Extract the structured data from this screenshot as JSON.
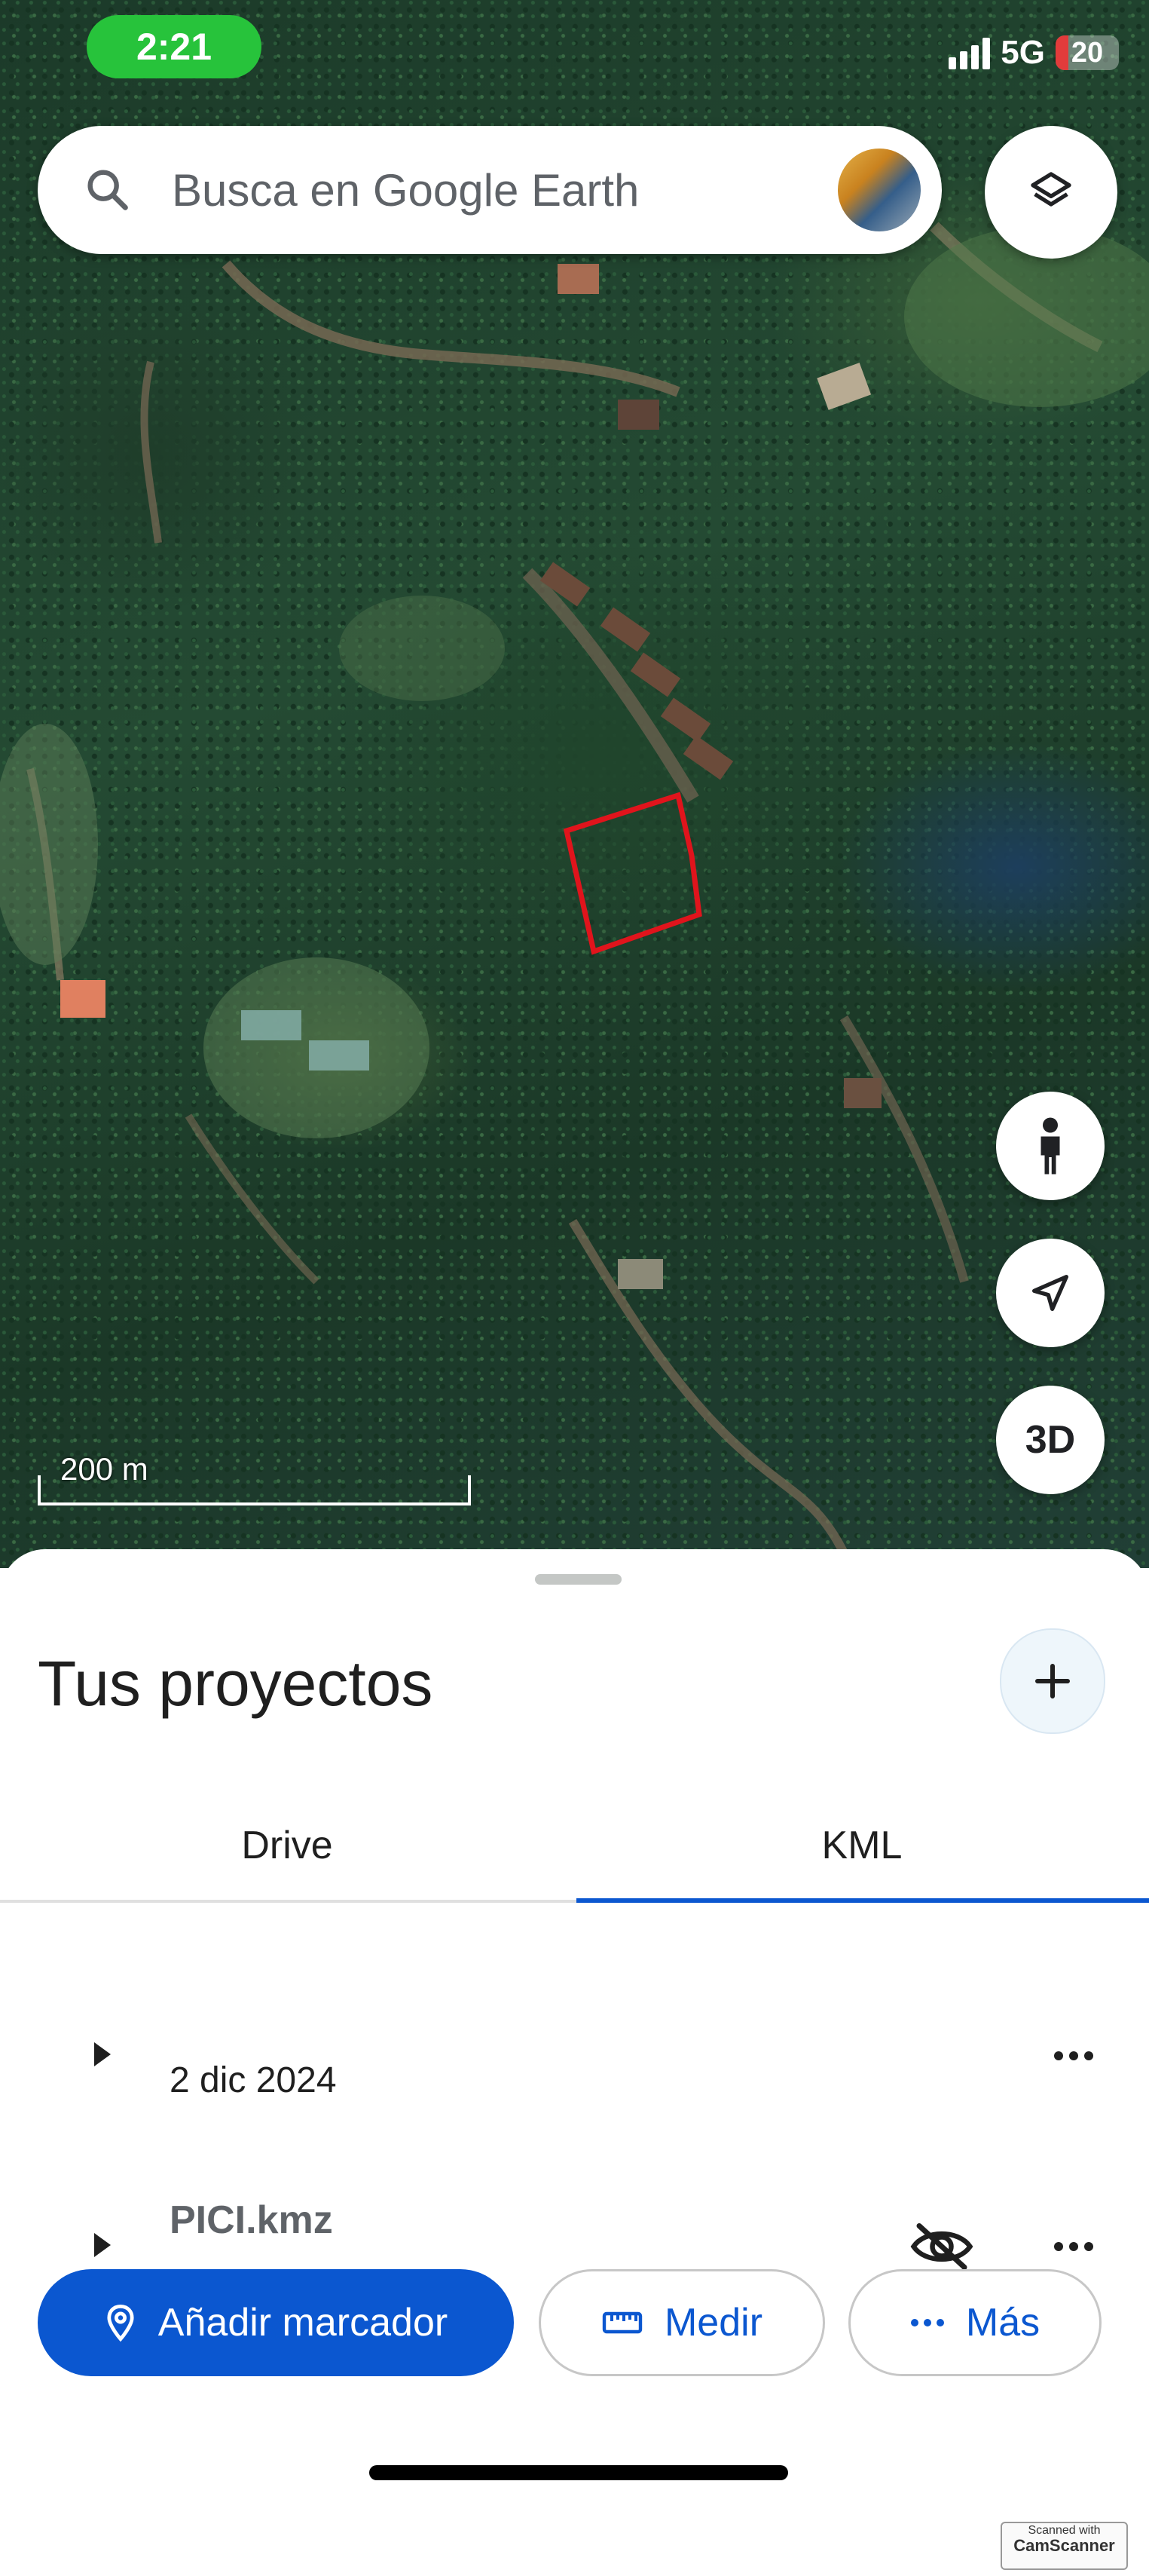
{
  "status_bar": {
    "time": "2:21",
    "network": "5G",
    "battery_level": "20",
    "battery_fraction": 0.2,
    "pill_color": "#27c33b"
  },
  "search": {
    "placeholder": "Busca en Google Earth",
    "icon": "search-icon"
  },
  "map": {
    "scale_label": "200 m",
    "buttons": {
      "layers": "layers-icon",
      "street_view": "pegman-icon",
      "location": "navigation-arrow-icon",
      "three_d_label": "3D"
    },
    "polygon_color": "#e0141c"
  },
  "sheet": {
    "title": "Tus proyectos",
    "add_icon": "plus-icon",
    "tabs": [
      {
        "label": "Drive",
        "selected": false
      },
      {
        "label": "KML",
        "selected": true
      }
    ],
    "items": [
      {
        "label": "2 dic 2024",
        "menu_icon": "more-horiz-icon"
      },
      {
        "label": "PICI.kmz",
        "visibility_icon": "visibility-off-icon",
        "menu_icon": "more-horiz-icon"
      }
    ],
    "actions": {
      "add_marker": "Añadir marcador",
      "measure": "Medir",
      "more": "Más"
    }
  },
  "colors": {
    "accent": "#0b57d0",
    "text": "#1f1f1f"
  },
  "watermark": {
    "line1": "Scanned with",
    "line2": "CamScanner"
  }
}
